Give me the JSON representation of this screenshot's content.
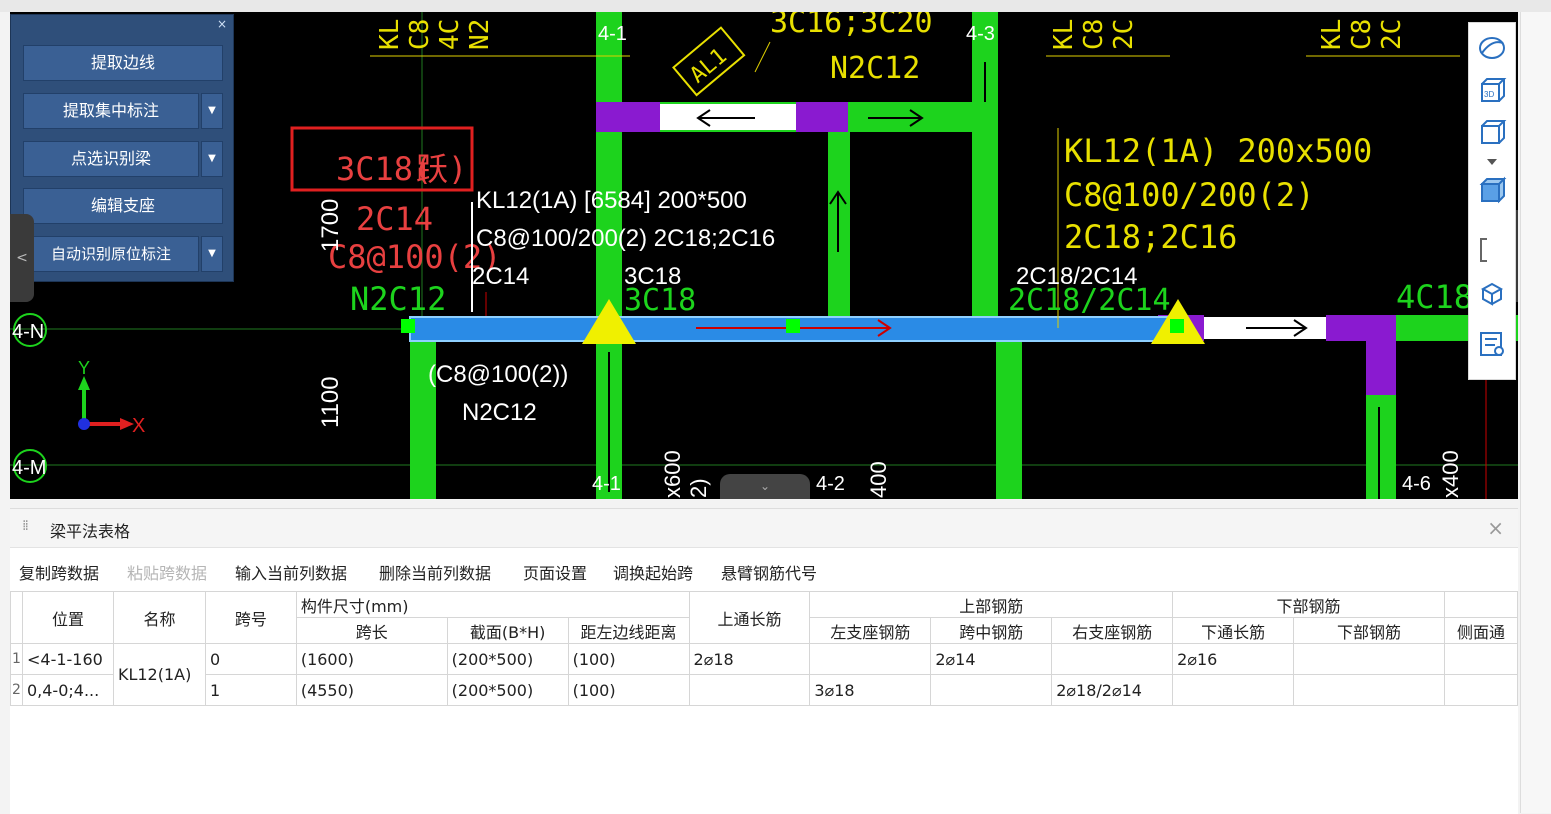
{
  "panel": {
    "close": "×",
    "buttons": [
      {
        "label": "提取边线",
        "dropdown": false
      },
      {
        "label": "提取集中标注",
        "dropdown": true
      },
      {
        "label": "点选识别梁",
        "dropdown": true
      },
      {
        "label": "编辑支座",
        "dropdown": false
      },
      {
        "label": "自动识别原位标注",
        "dropdown": true
      }
    ],
    "dropdown_glyph": "▼"
  },
  "canvas": {
    "grid_labels": [
      "4-1",
      "4-3",
      "4-N",
      "4-M",
      "4-1",
      "4-2",
      "4-6"
    ],
    "highlight_text": "3C18(",
    "highlight_text2": "1",
    "red_annotations": [
      "2C14",
      "C8@100(2)"
    ],
    "green_annotations": [
      "N2C12",
      "N2C12",
      "3C18",
      "2C18/2C14",
      "4C18"
    ],
    "yellow_annotations": [
      "KL12(1A) 200x500",
      "C8@100/200(2)",
      "2C18;2C16",
      "3C16;3C20",
      "KL",
      "C8",
      "4C",
      "N2"
    ],
    "white_annotations": [
      "KL12(1A) [6584] 200*500",
      "C8@100/200(2) 2C18;2C16",
      "2C14",
      "3C18",
      "2C18/2C14",
      "(C8@100(2))",
      "N2C12"
    ],
    "dims": [
      "1700",
      "1100"
    ],
    "axis_x": "X",
    "axis_y": "Y",
    "tag_label": "AL1",
    "small_labels": [
      "x600",
      "2)",
      "400",
      "x400"
    ]
  },
  "tabs": {
    "left": "<",
    "right": ">",
    "bottom": "⌄"
  },
  "right_toolbar": [
    "orbit-icon",
    "3d-view-icon",
    "box-view-icon",
    "expand-icon",
    "solid-box-icon",
    "bracket-select-icon",
    "layer-box-icon",
    "list-view-icon"
  ],
  "table_panel": {
    "title": "梁平法表格",
    "close": "×",
    "toolbar": [
      {
        "label": "复制跨数据",
        "enabled": true
      },
      {
        "label": "粘贴跨数据",
        "enabled": false
      },
      {
        "label": "输入当前列数据",
        "enabled": true
      },
      {
        "label": "删除当前列数据",
        "enabled": true
      },
      {
        "label": "页面设置",
        "enabled": true
      },
      {
        "label": "调换起始跨",
        "enabled": true
      },
      {
        "label": "悬臂钢筋代号",
        "enabled": true
      }
    ],
    "headers": {
      "position": "位置",
      "name": "名称",
      "span_no": "跨号",
      "size_group": "构件尺寸(mm)",
      "span_len": "跨长",
      "section": "截面(B*H)",
      "edge_dist": "距左边线距离",
      "top_through": "上通长筋",
      "top_group": "上部钢筋",
      "left_support": "左支座钢筋",
      "mid_span": "跨中钢筋",
      "right_support": "右支座钢筋",
      "bottom_group": "下部钢筋",
      "bottom_through": "下通长筋",
      "bottom_bar": "下部钢筋",
      "side": "侧面通"
    },
    "rows": [
      {
        "rownum": "1",
        "position": "<4-1-160",
        "span_no": "0",
        "span_len": "(1600)",
        "section": "(200*500)",
        "edge_dist": "(100)",
        "top_through": "2⌀18",
        "left_support": "",
        "mid_span": "2⌀14",
        "right_support": "",
        "bottom_through": "2⌀16",
        "bottom_bar": "",
        "side": ""
      },
      {
        "rownum": "2",
        "position": "0,4-0;4...",
        "span_no": "1",
        "span_len": "(4550)",
        "section": "(200*500)",
        "edge_dist": "(100)",
        "top_through": "",
        "left_support": "3⌀18",
        "mid_span": "",
        "right_support": "2⌀18/2⌀14",
        "bottom_through": "",
        "bottom_bar": "",
        "side": ""
      }
    ],
    "name_merged": "KL12(1A)"
  }
}
